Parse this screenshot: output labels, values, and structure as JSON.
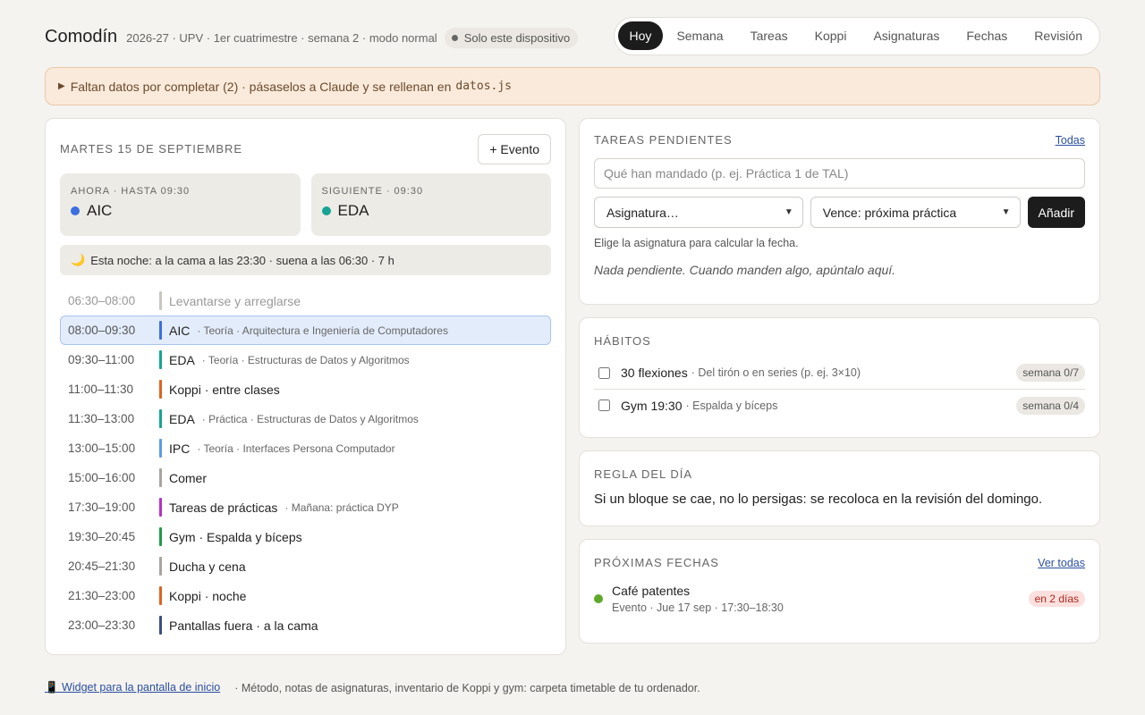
{
  "header": {
    "title": "Comodín",
    "meta": "2026-27 · UPV · 1er cuatrimestre · semana 2 · modo normal",
    "device_badge": "Solo este dispositivo",
    "tabs": [
      {
        "label": "Hoy",
        "active": true
      },
      {
        "label": "Semana"
      },
      {
        "label": "Tareas"
      },
      {
        "label": "Koppi"
      },
      {
        "label": "Asignaturas"
      },
      {
        "label": "Fechas"
      },
      {
        "label": "Revisión"
      }
    ]
  },
  "notice": {
    "text": "Faltan datos por completar (2) · pásaselos a Claude y se rellenan en",
    "file": "datos.js"
  },
  "today": {
    "date_label": "Martes 15 de septiembre",
    "event_button": "+ Evento",
    "now": {
      "label": "Ahora · hasta 09:30",
      "value": "AIC",
      "color": "#3b6fe0"
    },
    "next": {
      "label": "Siguiente · 09:30",
      "value": "EDA",
      "color": "#16a394"
    },
    "night": "Esta noche: a la cama a las 23:30 · suena a las 06:30 · 7 h",
    "schedule": [
      {
        "time": "06:30–08:00",
        "name": "Levantarse y arreglarse",
        "detail": "",
        "color": "#c9c6c0",
        "state": "past"
      },
      {
        "time": "08:00–09:30",
        "name": "AIC",
        "detail": "· Teoría · Arquitectura e Ingeniería de Computadores",
        "color": "#3b6fe0",
        "state": "current"
      },
      {
        "time": "09:30–11:00",
        "name": "EDA",
        "detail": "· Teoría · Estructuras de Datos y Algoritmos",
        "color": "#16a394",
        "state": ""
      },
      {
        "time": "11:00–11:30",
        "name": "Koppi · entre clases",
        "detail": "",
        "color": "#e0631e",
        "state": ""
      },
      {
        "time": "11:30–13:00",
        "name": "EDA",
        "detail": "· Práctica · Estructuras de Datos y Algoritmos",
        "color": "#16a394",
        "state": ""
      },
      {
        "time": "13:00–15:00",
        "name": "IPC",
        "detail": "· Teoría · Interfaces Persona Computador",
        "color": "#5b9be8",
        "state": ""
      },
      {
        "time": "15:00–16:00",
        "name": "Comer",
        "detail": "",
        "color": "#a8a49e",
        "state": ""
      },
      {
        "time": "17:30–19:00",
        "name": "Tareas de prácticas",
        "detail": "· Mañana: práctica DYP",
        "color": "#b531c9",
        "state": ""
      },
      {
        "time": "19:30–20:45",
        "name": "Gym · Espalda y bíceps",
        "detail": "",
        "color": "#1f9a4a",
        "state": ""
      },
      {
        "time": "20:45–21:30",
        "name": "Ducha y cena",
        "detail": "",
        "color": "#a8a49e",
        "state": ""
      },
      {
        "time": "21:30–23:00",
        "name": "Koppi · noche",
        "detail": "",
        "color": "#e0631e",
        "state": ""
      },
      {
        "time": "23:00–23:30",
        "name": "Pantallas fuera · a la cama",
        "detail": "",
        "color": "#3c4d80",
        "state": ""
      }
    ]
  },
  "tasks": {
    "title": "Tareas pendientes",
    "all_link": "Todas",
    "input_placeholder": "Qué han mandado (p. ej. Práctica 1 de TAL)",
    "subject_select": "Asignatura…",
    "due_select": "Vence: próxima práctica",
    "add_button": "Añadir",
    "hint": "Elige la asignatura para calcular la fecha.",
    "empty": "Nada pendiente. Cuando manden algo, apúntalo aquí."
  },
  "habits": {
    "title": "Hábitos",
    "items": [
      {
        "name": "30 flexiones",
        "detail": "· Del tirón o en series (p. ej. 3×10)",
        "badge": "semana 0/7"
      },
      {
        "name": "Gym 19:30",
        "detail": "· Espalda y bíceps",
        "badge": "semana 0/4"
      }
    ]
  },
  "rule": {
    "title": "Regla del día",
    "text": "Si un bloque se cae, no lo persigas: se recoloca en la revisión del domingo."
  },
  "dates": {
    "title": "Próximas fechas",
    "all_link": "Ver todas",
    "items": [
      {
        "name": "Café patentes",
        "sub": "Evento · Jue 17 sep · 17:30–18:30",
        "badge": "en 2 días",
        "color": "#5ea82a"
      }
    ]
  },
  "footer": {
    "widget_link": "📱 Widget para la pantalla de inicio",
    "text": "· Método, notas de asignaturas, inventario de Koppi y gym: carpeta timetable de tu ordenador."
  }
}
